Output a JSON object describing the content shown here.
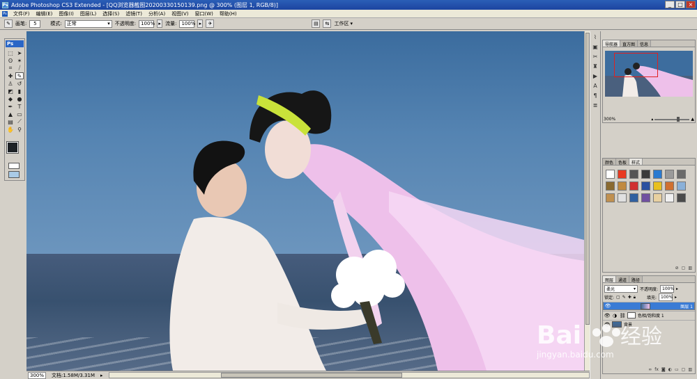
{
  "window": {
    "app_icon": "Ps",
    "title": "Adobe Photoshop CS3 Extended - [QQ浏览器截图20200330150139.png @ 300% (图层 1, RGB/8)]",
    "min": "_",
    "max": "□",
    "close": "×"
  },
  "menu": {
    "ps_icon": "Ps",
    "items": [
      "文件(F)",
      "编辑(E)",
      "图像(I)",
      "图层(L)",
      "选择(S)",
      "滤镜(T)",
      "分析(A)",
      "视图(V)",
      "窗口(W)",
      "帮助(H)"
    ]
  },
  "options": {
    "brush_label": "画笔:",
    "brush_size": "5",
    "mode_label": "模式:",
    "mode_value": "正常",
    "opacity_label": "不透明度:",
    "opacity_value": "100%",
    "flow_label": "流量:",
    "flow_value": "100%",
    "workspace": "工作区"
  },
  "toolbox": {
    "title": "Ps"
  },
  "canvas": {
    "accent_sky": "#4a7aab",
    "accent_dress": "#f0c8ee"
  },
  "status": {
    "zoom": "300%",
    "doc": "文档:1.58M/3.31M"
  },
  "navigator": {
    "tabs": [
      "导航器",
      "直方图",
      "信息"
    ],
    "zoom": "300%"
  },
  "styles": {
    "tabs": [
      "颜色",
      "色板",
      "样式"
    ],
    "swatches": [
      "#ffffff",
      "#e83a20",
      "#555555",
      "#3a3a3a",
      "#2a7ad0",
      "#9a9a9a",
      "#6a6a6a",
      "#8a6a30",
      "#c08a40",
      "#d03030",
      "#2a50a0",
      "#e8c020",
      "#d07030",
      "#8ab0d8",
      "#c09050",
      "#e0e0e0",
      "#3060a0",
      "#7050a0",
      "#e8d0a0",
      "#f0f0f0",
      "#4a4a4a"
    ]
  },
  "layers": {
    "tabs": [
      "图层",
      "通道",
      "路径"
    ],
    "blend_mode": "柔光",
    "opacity_label": "不透明度:",
    "opacity_value": "100%",
    "lock_label": "锁定:",
    "fill_label": "填充:",
    "fill_value": "100%",
    "items": [
      {
        "name": "图层 1",
        "selected": true
      },
      {
        "name": "色相/饱和度 1",
        "selected": false
      },
      {
        "name": "背景",
        "selected": false
      }
    ]
  },
  "watermark": {
    "brand_a": "Bai",
    "brand_b": "经验",
    "url": "jingyan.baidu.com"
  }
}
